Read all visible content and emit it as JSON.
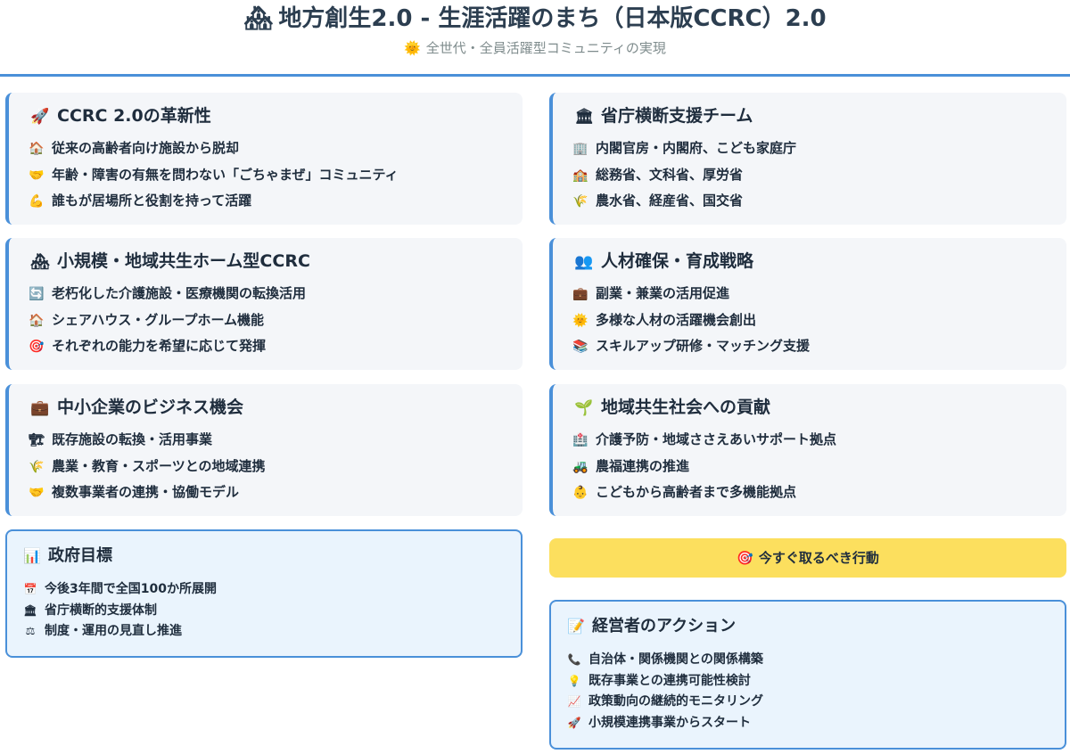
{
  "header": {
    "title_icon": "🏘",
    "title": "地方創生2.0 - 生涯活躍のまち（日本版CCRC）2.0",
    "subtitle_icon": "🌞",
    "subtitle": "全世代・全員活躍型コミュニティの実現"
  },
  "cards": {
    "innovation": {
      "icon": "🚀",
      "title": "CCRC 2.0の革新性",
      "items": [
        {
          "icon": "🏠",
          "text": "従来の高齢者向け施設から脱却"
        },
        {
          "icon": "🤝",
          "text": "年齢・障害の有無を問わない「ごちゃまぜ」コミュニティ"
        },
        {
          "icon": "💪",
          "text": "誰もが居場所と役割を持って活躍"
        }
      ]
    },
    "ministries": {
      "icon": "🏛",
      "title": "省庁横断支援チーム",
      "items": [
        {
          "icon": "🏢",
          "text": "内閣官房・内閣府、こども家庭庁"
        },
        {
          "icon": "🏫",
          "text": "総務省、文科省、厚労省"
        },
        {
          "icon": "🌾",
          "text": "農水省、経産省、国交省"
        }
      ]
    },
    "small_scale": {
      "icon": "🏘",
      "title": "小規模・地域共生ホーム型CCRC",
      "items": [
        {
          "icon": "🔄",
          "text": "老朽化した介護施設・医療機関の転換活用"
        },
        {
          "icon": "🏠",
          "text": "シェアハウス・グループホーム機能"
        },
        {
          "icon": "🎯",
          "text": "それぞれの能力を希望に応じて発揮"
        }
      ]
    },
    "talent": {
      "icon": "👥",
      "title": "人材確保・育成戦略",
      "items": [
        {
          "icon": "💼",
          "text": "副業・兼業の活用促進"
        },
        {
          "icon": "🌞",
          "text": "多様な人材の活躍機会創出"
        },
        {
          "icon": "📚",
          "text": "スキルアップ研修・マッチング支援"
        }
      ]
    },
    "sme": {
      "icon": "💼",
      "title": "中小企業のビジネス機会",
      "items": [
        {
          "icon": "🏗",
          "text": "既存施設の転換・活用事業"
        },
        {
          "icon": "🌾",
          "text": "農業・教育・スポーツとの地域連携"
        },
        {
          "icon": "🤝",
          "text": "複数事業者の連携・協働モデル"
        }
      ]
    },
    "community": {
      "icon": "🌱",
      "title": "地域共生社会への貢献",
      "items": [
        {
          "icon": "🏥",
          "text": "介護予防・地域ささえあいサポート拠点"
        },
        {
          "icon": "🚜",
          "text": "農福連携の推進"
        },
        {
          "icon": "👶",
          "text": "こどもから高齢者まで多機能拠点"
        }
      ]
    }
  },
  "gov_goals": {
    "icon": "📊",
    "title": "政府目標",
    "items": [
      {
        "icon": "📅",
        "text": "今後3年間で全国100か所展開"
      },
      {
        "icon": "🏛",
        "text": "省庁横断的支援体制"
      },
      {
        "icon": "⚖",
        "text": "制度・運用の見直し推進"
      }
    ]
  },
  "cta": {
    "icon": "🎯",
    "label": "今すぐ取るべき行動"
  },
  "actions": {
    "icon": "📝",
    "title": "経営者のアクション",
    "items": [
      {
        "icon": "📞",
        "text": "自治体・関係機関との関係構築"
      },
      {
        "icon": "💡",
        "text": "既存事業との連携可能性検討"
      },
      {
        "icon": "📈",
        "text": "政策動向の継続的モニタリング"
      },
      {
        "icon": "🚀",
        "text": "小規模連携事業からスタート"
      }
    ]
  },
  "colors": {
    "accent": "#4a90d9",
    "card_bg": "#f4f6f9",
    "box_bg": "#eaf4fd",
    "cta_bg": "#fcdf5e"
  }
}
